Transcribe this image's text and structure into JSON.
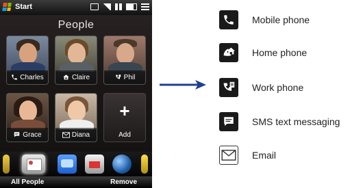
{
  "phone": {
    "status_bar": {
      "start_label": "Start",
      "icons": [
        "sync-icon",
        "signal-icon",
        "volume-icon",
        "battery-icon",
        "menu-icon"
      ]
    },
    "screen_title": "People",
    "contacts": [
      {
        "name": "Charles",
        "icon": "mobile-phone-icon"
      },
      {
        "name": "Claire",
        "icon": "home-phone-icon"
      },
      {
        "name": "Phil",
        "icon": "work-phone-icon"
      },
      {
        "name": "Grace",
        "icon": "sms-icon"
      },
      {
        "name": "Diana",
        "icon": "email-icon"
      },
      {
        "name": "Add",
        "icon": "plus-icon"
      }
    ],
    "dock_icons": [
      "phone-icon",
      "people-icon",
      "messaging-icon",
      "mail-icon",
      "internet-icon",
      "music-icon"
    ],
    "softkeys": {
      "left": "All People",
      "right": "Remove"
    }
  },
  "legend": [
    {
      "icon": "mobile-phone-icon",
      "label": "Mobile phone"
    },
    {
      "icon": "home-phone-icon",
      "label": "Home phone"
    },
    {
      "icon": "work-phone-icon",
      "label": "Work phone"
    },
    {
      "icon": "sms-icon",
      "label": "SMS text messaging"
    },
    {
      "icon": "email-icon",
      "label": "Email"
    }
  ],
  "colors": {
    "arrow": "#1f3f8f",
    "icon_bg": "#1a1a1a"
  }
}
